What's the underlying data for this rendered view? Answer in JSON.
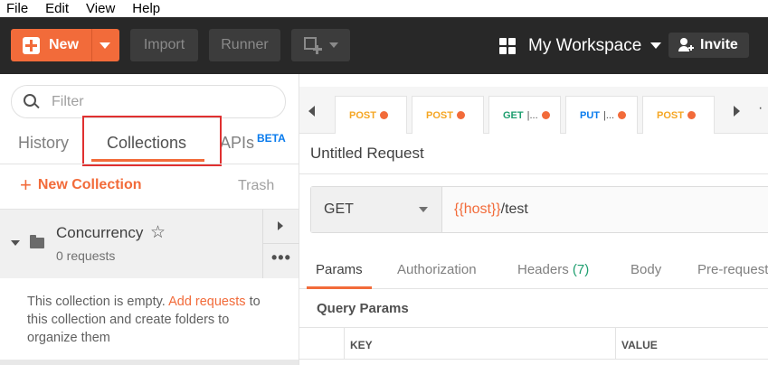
{
  "menubar": {
    "items": [
      "File",
      "Edit",
      "View",
      "Help"
    ]
  },
  "toolbar": {
    "new_label": "New",
    "import_label": "Import",
    "runner_label": "Runner",
    "workspace_label": "My Workspace",
    "invite_label": "Invite"
  },
  "sidebar": {
    "filter_placeholder": "Filter",
    "tabs": {
      "history": "History",
      "collections": "Collections",
      "apis": "APIs",
      "beta": "BETA"
    },
    "new_collection_label": "New Collection",
    "trash_label": "Trash",
    "collection": {
      "name": "Concurrency",
      "count": "0 requests"
    },
    "empty_msg_pre": "This collection is empty.",
    "empty_msg_link": "Add requests",
    "empty_msg_post": "to this collection and create folders to organize them"
  },
  "main": {
    "request_tabs": [
      {
        "method": "POST",
        "suffix": ""
      },
      {
        "method": "POST",
        "suffix": ""
      },
      {
        "method": "GET",
        "suffix": "|..."
      },
      {
        "method": "PUT",
        "suffix": "|..."
      },
      {
        "method": "POST",
        "suffix": ""
      }
    ],
    "request_title": "Untitled Request",
    "method": "GET",
    "url_var": "{{host}}",
    "url_path": "/test",
    "sub_tabs": {
      "params": "Params",
      "authorization": "Authorization",
      "headers": "Headers",
      "headers_count": "(7)",
      "body": "Body",
      "prerequest": "Pre-request"
    },
    "query_params_title": "Query Params",
    "columns": {
      "key": "KEY",
      "value": "VALUE"
    }
  },
  "colors": {
    "accent": "#f26b3a",
    "header_bg": "#282828",
    "post": "#f5a623",
    "get": "#1e9e6f",
    "put": "#097bed",
    "beta": "#097bed"
  }
}
